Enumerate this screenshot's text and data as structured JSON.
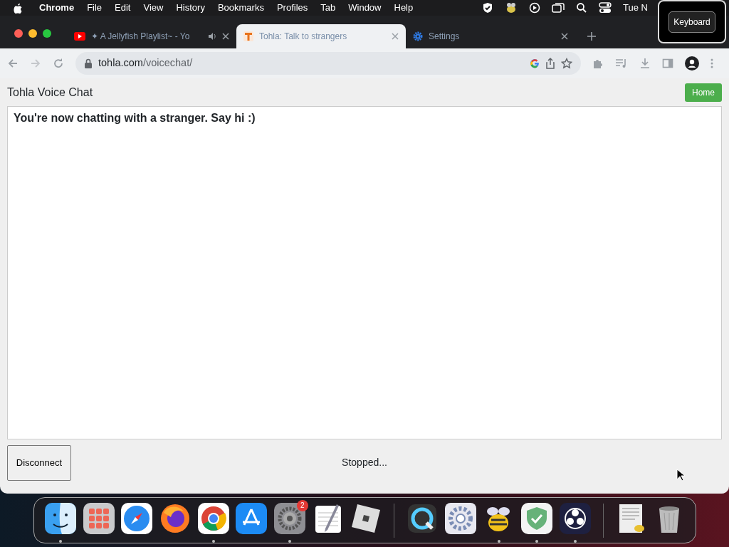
{
  "menu_bar": {
    "items": [
      {
        "label": "Chrome",
        "bold": true
      },
      {
        "label": "File",
        "bold": false
      },
      {
        "label": "Edit",
        "bold": false
      },
      {
        "label": "View",
        "bold": false
      },
      {
        "label": "History",
        "bold": false
      },
      {
        "label": "Bookmarks",
        "bold": false
      },
      {
        "label": "Profiles",
        "bold": false
      },
      {
        "label": "Tab",
        "bold": false
      },
      {
        "label": "Window",
        "bold": false
      },
      {
        "label": "Help",
        "bold": false
      }
    ],
    "clock": "Tue N",
    "popup": "Keyboard"
  },
  "tabs": [
    {
      "title": "✦ A Jellyfish Playlist~ - Yo",
      "selected": false,
      "kind": "video",
      "playing_audio": true
    },
    {
      "title": "Tohla: Talk to strangers",
      "selected": true,
      "kind": "letter",
      "playing_audio": false
    },
    {
      "title": "Settings",
      "selected": false,
      "kind": "gear",
      "playing_audio": false
    }
  ],
  "address_bar": {
    "domain": "tohla.com",
    "path": "/voicechat/"
  },
  "page": {
    "title": "Tohla Voice Chat",
    "home_button": "Home",
    "message": "You're now chatting with a stranger. Say hi :)",
    "disconnect_button": "Disconnect",
    "status": "Stopped..."
  },
  "dock": {
    "groups": [
      [
        {
          "kind": "finder",
          "running": true
        },
        {
          "kind": "launchpad",
          "running": false
        },
        {
          "kind": "safari",
          "running": false
        },
        {
          "kind": "firefox",
          "running": false
        },
        {
          "kind": "chrome",
          "running": true
        },
        {
          "kind": "appstore",
          "running": false
        },
        {
          "kind": "settings",
          "running": true,
          "badge": "2"
        },
        {
          "kind": "textedit",
          "running": false
        },
        {
          "kind": "roblox",
          "running": false
        }
      ],
      [
        {
          "kind": "quicktime",
          "running": false
        },
        {
          "kind": "gear",
          "running": false
        },
        {
          "kind": "bee",
          "running": true
        },
        {
          "kind": "shield",
          "running": true
        },
        {
          "kind": "obs",
          "running": true
        }
      ],
      [
        {
          "kind": "notes",
          "running": false
        },
        {
          "kind": "trash",
          "running": false
        }
      ]
    ]
  }
}
